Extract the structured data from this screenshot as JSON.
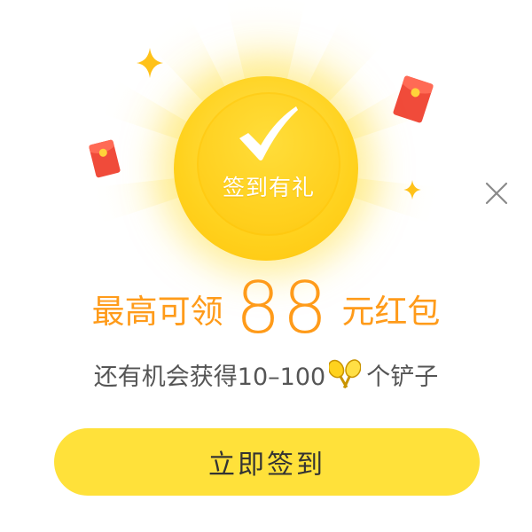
{
  "badge": {
    "label": "签到有礼"
  },
  "headline": {
    "prefix": "最高可领",
    "amount": "88",
    "suffix": "元红包"
  },
  "subline": {
    "prefix": "还有机会获得10–100",
    "suffix": "个铲子"
  },
  "cta": {
    "label": "立即签到"
  },
  "icons": {
    "check": "checkmark-icon",
    "close": "close-icon",
    "shovel": "shovel-icon",
    "sparkle": "sparkle-icon",
    "red_envelope": "red-envelope-icon"
  },
  "colors": {
    "accent_orange": "#ff9b1a",
    "coin_yellow": "#ffd21e",
    "button_yellow": "#ffe13a",
    "envelope_red": "#f04b3a"
  }
}
